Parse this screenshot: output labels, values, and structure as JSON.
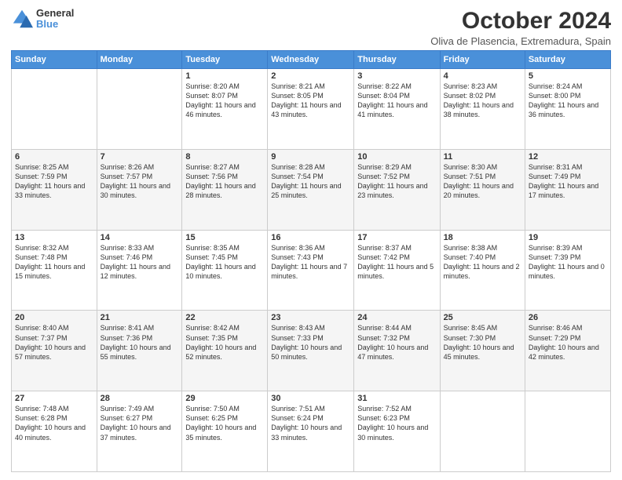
{
  "logo": {
    "general": "General",
    "blue": "Blue"
  },
  "title": "October 2024",
  "subtitle": "Oliva de Plasencia, Extremadura, Spain",
  "days_of_week": [
    "Sunday",
    "Monday",
    "Tuesday",
    "Wednesday",
    "Thursday",
    "Friday",
    "Saturday"
  ],
  "weeks": [
    [
      {
        "day": "",
        "info": ""
      },
      {
        "day": "",
        "info": ""
      },
      {
        "day": "1",
        "info": "Sunrise: 8:20 AM\nSunset: 8:07 PM\nDaylight: 11 hours and 46 minutes."
      },
      {
        "day": "2",
        "info": "Sunrise: 8:21 AM\nSunset: 8:05 PM\nDaylight: 11 hours and 43 minutes."
      },
      {
        "day": "3",
        "info": "Sunrise: 8:22 AM\nSunset: 8:04 PM\nDaylight: 11 hours and 41 minutes."
      },
      {
        "day": "4",
        "info": "Sunrise: 8:23 AM\nSunset: 8:02 PM\nDaylight: 11 hours and 38 minutes."
      },
      {
        "day": "5",
        "info": "Sunrise: 8:24 AM\nSunset: 8:00 PM\nDaylight: 11 hours and 36 minutes."
      }
    ],
    [
      {
        "day": "6",
        "info": "Sunrise: 8:25 AM\nSunset: 7:59 PM\nDaylight: 11 hours and 33 minutes."
      },
      {
        "day": "7",
        "info": "Sunrise: 8:26 AM\nSunset: 7:57 PM\nDaylight: 11 hours and 30 minutes."
      },
      {
        "day": "8",
        "info": "Sunrise: 8:27 AM\nSunset: 7:56 PM\nDaylight: 11 hours and 28 minutes."
      },
      {
        "day": "9",
        "info": "Sunrise: 8:28 AM\nSunset: 7:54 PM\nDaylight: 11 hours and 25 minutes."
      },
      {
        "day": "10",
        "info": "Sunrise: 8:29 AM\nSunset: 7:52 PM\nDaylight: 11 hours and 23 minutes."
      },
      {
        "day": "11",
        "info": "Sunrise: 8:30 AM\nSunset: 7:51 PM\nDaylight: 11 hours and 20 minutes."
      },
      {
        "day": "12",
        "info": "Sunrise: 8:31 AM\nSunset: 7:49 PM\nDaylight: 11 hours and 17 minutes."
      }
    ],
    [
      {
        "day": "13",
        "info": "Sunrise: 8:32 AM\nSunset: 7:48 PM\nDaylight: 11 hours and 15 minutes."
      },
      {
        "day": "14",
        "info": "Sunrise: 8:33 AM\nSunset: 7:46 PM\nDaylight: 11 hours and 12 minutes."
      },
      {
        "day": "15",
        "info": "Sunrise: 8:35 AM\nSunset: 7:45 PM\nDaylight: 11 hours and 10 minutes."
      },
      {
        "day": "16",
        "info": "Sunrise: 8:36 AM\nSunset: 7:43 PM\nDaylight: 11 hours and 7 minutes."
      },
      {
        "day": "17",
        "info": "Sunrise: 8:37 AM\nSunset: 7:42 PM\nDaylight: 11 hours and 5 minutes."
      },
      {
        "day": "18",
        "info": "Sunrise: 8:38 AM\nSunset: 7:40 PM\nDaylight: 11 hours and 2 minutes."
      },
      {
        "day": "19",
        "info": "Sunrise: 8:39 AM\nSunset: 7:39 PM\nDaylight: 11 hours and 0 minutes."
      }
    ],
    [
      {
        "day": "20",
        "info": "Sunrise: 8:40 AM\nSunset: 7:37 PM\nDaylight: 10 hours and 57 minutes."
      },
      {
        "day": "21",
        "info": "Sunrise: 8:41 AM\nSunset: 7:36 PM\nDaylight: 10 hours and 55 minutes."
      },
      {
        "day": "22",
        "info": "Sunrise: 8:42 AM\nSunset: 7:35 PM\nDaylight: 10 hours and 52 minutes."
      },
      {
        "day": "23",
        "info": "Sunrise: 8:43 AM\nSunset: 7:33 PM\nDaylight: 10 hours and 50 minutes."
      },
      {
        "day": "24",
        "info": "Sunrise: 8:44 AM\nSunset: 7:32 PM\nDaylight: 10 hours and 47 minutes."
      },
      {
        "day": "25",
        "info": "Sunrise: 8:45 AM\nSunset: 7:30 PM\nDaylight: 10 hours and 45 minutes."
      },
      {
        "day": "26",
        "info": "Sunrise: 8:46 AM\nSunset: 7:29 PM\nDaylight: 10 hours and 42 minutes."
      }
    ],
    [
      {
        "day": "27",
        "info": "Sunrise: 7:48 AM\nSunset: 6:28 PM\nDaylight: 10 hours and 40 minutes."
      },
      {
        "day": "28",
        "info": "Sunrise: 7:49 AM\nSunset: 6:27 PM\nDaylight: 10 hours and 37 minutes."
      },
      {
        "day": "29",
        "info": "Sunrise: 7:50 AM\nSunset: 6:25 PM\nDaylight: 10 hours and 35 minutes."
      },
      {
        "day": "30",
        "info": "Sunrise: 7:51 AM\nSunset: 6:24 PM\nDaylight: 10 hours and 33 minutes."
      },
      {
        "day": "31",
        "info": "Sunrise: 7:52 AM\nSunset: 6:23 PM\nDaylight: 10 hours and 30 minutes."
      },
      {
        "day": "",
        "info": ""
      },
      {
        "day": "",
        "info": ""
      }
    ]
  ]
}
